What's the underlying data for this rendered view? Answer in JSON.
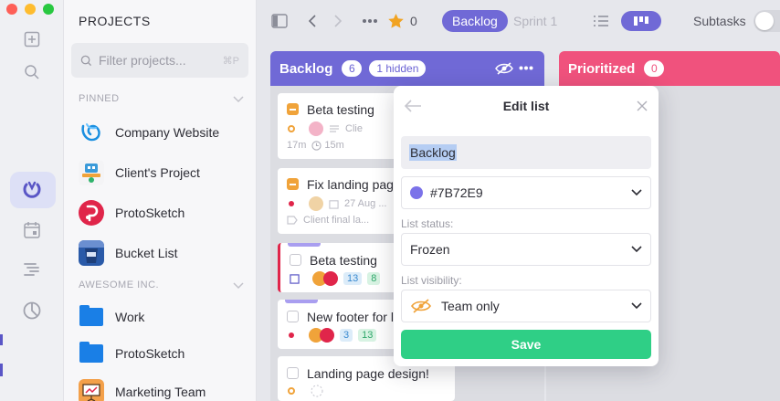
{
  "window": {
    "traffic_colors": [
      "#fe5f57",
      "#febc2e",
      "#28c840"
    ]
  },
  "sidebar": {
    "title": "PROJECTS",
    "search_placeholder": "Filter projects...",
    "search_shortcut": "⌘P",
    "sections": [
      {
        "label": "PINNED",
        "items": [
          {
            "label": "Company Website",
            "icon": "blue-spiral-logo"
          },
          {
            "label": "Client's Project",
            "icon": "robot-icon"
          },
          {
            "label": "ProtoSketch",
            "icon": "protosketch-logo"
          },
          {
            "label": "Bucket List",
            "icon": "bucket-list-icon"
          }
        ]
      },
      {
        "label": "AWESOME INC.",
        "items": [
          {
            "label": "Work",
            "icon": "folder-icon"
          },
          {
            "label": "ProtoSketch",
            "icon": "folder-icon"
          },
          {
            "label": "Marketing Team",
            "icon": "presentation-icon"
          }
        ]
      }
    ]
  },
  "toolbar": {
    "star_count": "0",
    "sprint_current": "Backlog",
    "sprint_next": "Sprint 1",
    "subtasks_label": "Subtasks"
  },
  "columns": [
    {
      "title": "Backlog",
      "count": "6",
      "hidden_label": "1 hidden",
      "color": "#7069d6"
    },
    {
      "title": "Prioritized",
      "count": "0",
      "color": "#f0527d"
    }
  ],
  "cards": [
    {
      "title": "Beta testing",
      "time_spent": "17m",
      "time_estimate": "15m",
      "tag": "Clie"
    },
    {
      "title": "Fix landing page",
      "date": "27 Aug ...",
      "tag": "Client final la..."
    },
    {
      "title": "Beta testing",
      "num1": "13",
      "num2": "8"
    },
    {
      "title": "New footer for l",
      "num1": "3",
      "num2": "13"
    },
    {
      "title": "Landing page design!"
    }
  ],
  "modal": {
    "title": "Edit list",
    "name_value": "Backlog",
    "color_value": "#7B72E9",
    "status_label": "List status:",
    "status_value": "Frozen",
    "visibility_label": "List visibility:",
    "visibility_value": "Team only",
    "save_label": "Save"
  }
}
